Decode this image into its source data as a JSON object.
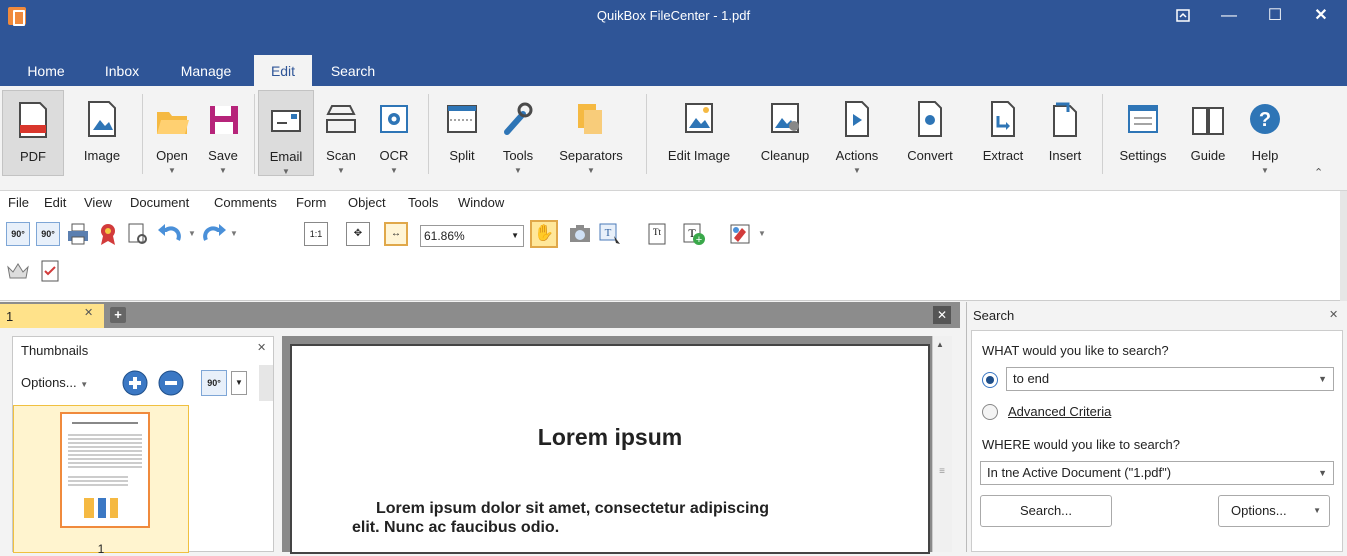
{
  "window": {
    "title": "QuikBox FileCenter - 1.pdf"
  },
  "tabs": [
    "Home",
    "Inbox",
    "Manage",
    "Edit",
    "Search"
  ],
  "ribbon": {
    "pdf": "PDF",
    "image": "Image",
    "open": "Open",
    "save": "Save",
    "email": "Email",
    "scan": "Scan",
    "ocr": "OCR",
    "split": "Split",
    "tools": "Tools",
    "separators": "Separators",
    "edit_image": "Edit Image",
    "cleanup": "Cleanup",
    "actions": "Actions",
    "convert": "Convert",
    "extract": "Extract",
    "insert": "Insert",
    "settings": "Settings",
    "guide": "Guide",
    "help": "Help"
  },
  "menu": [
    "File",
    "Edit",
    "View",
    "Document",
    "Comments",
    "Form",
    "Object",
    "Tools",
    "Window"
  ],
  "toolbar": {
    "zoom": "61.86%",
    "rotate_left": "90°",
    "rotate_right": "90°"
  },
  "doc_tab": {
    "label": "1"
  },
  "thumbnails": {
    "title": "Thumbnails",
    "options": "Options...",
    "rotate": "90°",
    "page_number": "1"
  },
  "page": {
    "heading": "Lorem ipsum",
    "paragraph_line1": "Lorem ipsum dolor sit amet, consectetur adipiscing",
    "paragraph_line2": "elit. Nunc ac faucibus odio."
  },
  "search": {
    "title": "Search",
    "what_label": "WHAT would you like to search?",
    "query": "to end",
    "advanced": "Advanced Criteria",
    "where_label": "WHERE would you like to search?",
    "where_value": "In tne Active Document (\"1.pdf\")",
    "search_button": "Search...",
    "options_button": "Options..."
  },
  "colors": {
    "titlebar": "#2f5597",
    "accent_orange": "#f08a3c",
    "doc_tab": "#ffe28a"
  }
}
